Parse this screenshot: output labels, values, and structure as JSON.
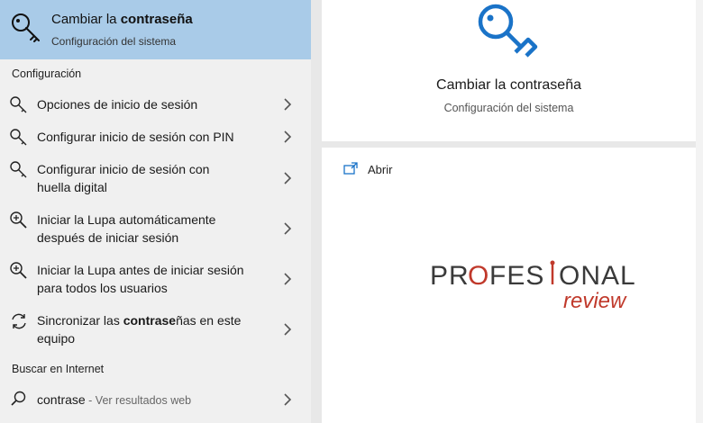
{
  "best_match": {
    "title_normal": "Cambiar la ",
    "title_bold": "contraseña",
    "subtitle": "Configuración del sistema"
  },
  "sections": {
    "settings": "Configuración",
    "internet": "Buscar en Internet"
  },
  "settings_items": [
    {
      "label": "Opciones de inicio de sesión",
      "icon": "key-icon"
    },
    {
      "label": "Configurar inicio de sesión con PIN",
      "icon": "key-icon"
    },
    {
      "label_line1": "Configurar inicio de sesión con",
      "label_line2": "huella digital",
      "icon": "key-icon"
    },
    {
      "label_line1": "Iniciar la Lupa automáticamente",
      "label_line2": "después de iniciar sesión",
      "icon": "magnifier-plus-icon"
    },
    {
      "label_line1": "Iniciar la Lupa antes de iniciar sesión",
      "label_line2": "para todos los usuarios",
      "icon": "magnifier-plus-icon"
    },
    {
      "line1_a": "Sincronizar las ",
      "line1_bold": "contrase",
      "line1_b": "ñas en este",
      "label_line2": "equipo",
      "icon": "sync-icon"
    }
  ],
  "web_search": {
    "query": "contrase",
    "suffix": " - Ver resultados web",
    "icon": "search-icon"
  },
  "preview": {
    "title": "Cambiar la contraseña",
    "subtitle": "Configuración del sistema",
    "open_label": "Abrir"
  },
  "watermark": {
    "line1": "PROFESIONAL",
    "line2": "review"
  },
  "colors": {
    "highlight": "#a9cbe8",
    "accent": "#1a73c8",
    "logo_red": "#c0392b",
    "logo_dark": "#3a3a3a"
  }
}
